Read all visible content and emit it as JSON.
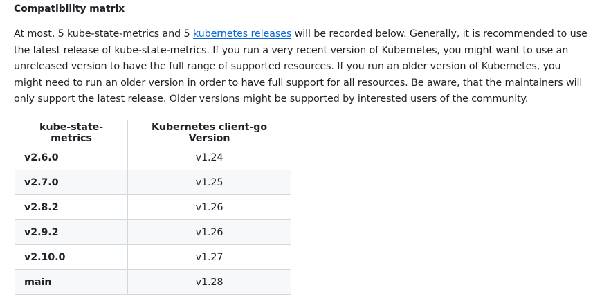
{
  "heading": "Compatibility matrix",
  "paragraph": {
    "before_link": "At most, 5 kube-state-metrics and 5 ",
    "link_text": "kubernetes releases",
    "after_link": " will be recorded below. Generally, it is recommended to use the latest release of kube-state-metrics. If you run a very recent version of Kubernetes, you might want to use an unreleased version to have the full range of supported resources. If you run an older version of Kubernetes, you might need to run an older version in order to have full support for all resources. Be aware, that the maintainers will only support the latest release. Older versions might be supported by interested users of the community."
  },
  "table": {
    "headers": [
      "kube-state-metrics",
      "Kubernetes client-go Version"
    ],
    "rows": [
      {
        "ksm": "v2.6.0",
        "client_go": "v1.24"
      },
      {
        "ksm": "v2.7.0",
        "client_go": "v1.25"
      },
      {
        "ksm": "v2.8.2",
        "client_go": "v1.26"
      },
      {
        "ksm": "v2.9.2",
        "client_go": "v1.26"
      },
      {
        "ksm": "v2.10.0",
        "client_go": "v1.27"
      },
      {
        "ksm": "main",
        "client_go": "v1.28"
      }
    ]
  },
  "colors": {
    "link": "#0969da",
    "text": "#1f2328",
    "table_border": "#d0d7de",
    "row_stripe": "#f6f8fa"
  }
}
